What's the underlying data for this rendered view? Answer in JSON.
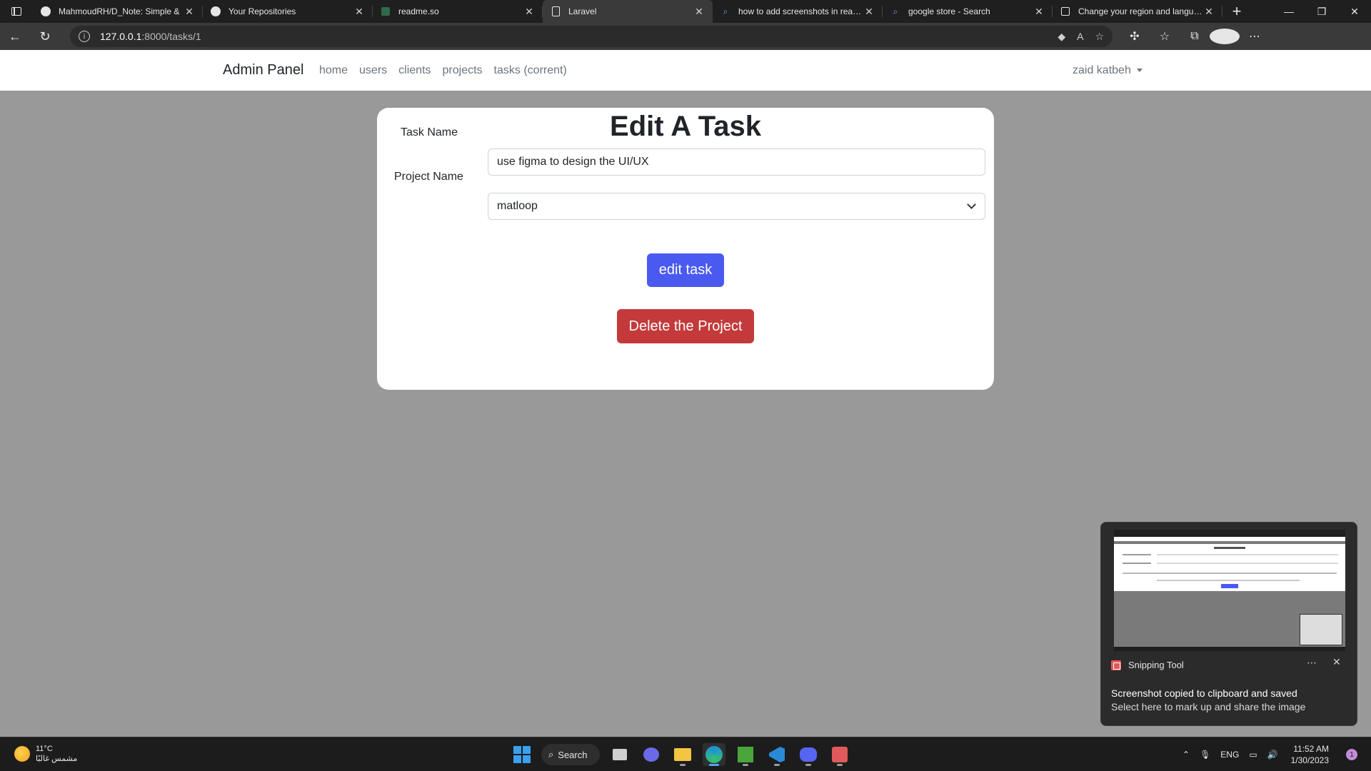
{
  "browser": {
    "tabs": [
      {
        "title": "MahmoudRH/D_Note: Simple &",
        "favicon": "github-icon"
      },
      {
        "title": "Your Repositories",
        "favicon": "github-icon"
      },
      {
        "title": "readme.so",
        "favicon": "readme-icon"
      },
      {
        "title": "Laravel",
        "favicon": "page-icon",
        "active": true
      },
      {
        "title": "how to add screenshots in readm",
        "favicon": "search-icon"
      },
      {
        "title": "google store - Search",
        "favicon": "search-icon"
      },
      {
        "title": "Change your region and languag",
        "favicon": "google-icon"
      }
    ],
    "url": {
      "host": "127.0.0.1",
      "path": ":8000/tasks/1"
    }
  },
  "navbar": {
    "brand": "Admin Panel",
    "links": [
      "home",
      "users",
      "clients",
      "projects",
      "tasks (corrent)"
    ],
    "user": "zaid katbeh"
  },
  "form": {
    "title": "Edit A Task",
    "task_label": "Task Name",
    "task_value": "use figma to design the UI/UX",
    "project_label": "Project Name",
    "project_value": "matloop",
    "submit_label": "edit task",
    "delete_label": "Delete the Project",
    "colors": {
      "primary": "#4a5af0",
      "danger": "#c43a3a"
    }
  },
  "toast": {
    "app": "Snipping Tool",
    "headline": "Screenshot copied to clipboard and saved",
    "subtext": "Select here to mark up and share the image",
    "preview_title": "add a project"
  },
  "taskbar": {
    "weather_temp": "11°C",
    "weather_cond": "مشمس غالبًا",
    "search_label": "Search",
    "language": "ENG",
    "time": "11:52 AM",
    "date": "1/30/2023",
    "notifications": "1"
  }
}
